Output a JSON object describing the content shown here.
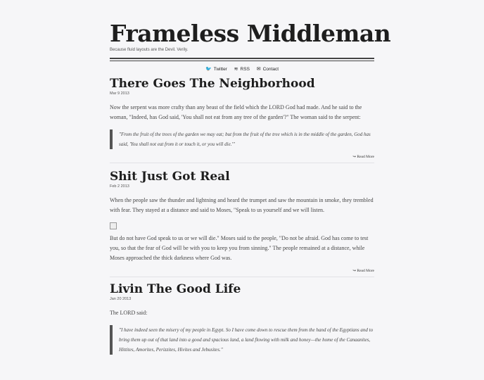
{
  "site": {
    "title": "Frameless Middleman",
    "tagline": "Because fluid layouts are the Devil. Verily."
  },
  "nav": [
    {
      "icon": "twitter-icon",
      "glyph": "🐦",
      "label": "Twitter"
    },
    {
      "icon": "rss-icon",
      "glyph": "≋",
      "label": "RSS"
    },
    {
      "icon": "envelope-icon",
      "glyph": "✉",
      "label": "Contact"
    }
  ],
  "posts": [
    {
      "title": "There Goes The Neighborhood",
      "date": "Mar 9 2013",
      "p1": "Now the serpent was more crafty than any beast of the field which the LORD God had made. And he said to the woman, \"Indeed, has God said, 'You shall not eat from any tree of the garden'?\" The woman said to the serpent:",
      "quote": "\"From the fruit of the trees of the garden we may eat; but from the fruit of the tree which is in the middle of the garden, God has said, 'You shall not eat from it or touch it, or you will die.'\"",
      "read_more": "Read More"
    },
    {
      "title": "Shit Just Got Real",
      "date": "Feb 2 2013",
      "p1": "When the people saw the thunder and lightning and heard the trumpet and saw the mountain in smoke, they trembled with fear. They stayed at a distance and said to Moses, \"Speak to us yourself and we will listen.",
      "p2": "But do not have God speak to us or we will die.\" Moses said to the people, \"Do not be afraid. God has come to test you, so that the fear of God will be with you to keep you from sinning.\" The people remained at a distance, while Moses approached the thick darkness where God was.",
      "read_more": "Read More"
    },
    {
      "title": "Livin The Good Life",
      "date": "Jan 20 2013",
      "p1": "The LORD said:",
      "quote": "\"I have indeed seen the misery of my people in Egypt. So I have come down to rescue them from the hand of the Egyptians and to bring them up out of that land into a good and spacious land, a land flowing with milk and honey—the home of the Canaanites, Hittites, Amorites, Perizzites, Hivites and Jebusites.\""
    }
  ],
  "colors": {
    "background": "#f6f6f8",
    "text": "#333333",
    "rule": "#444444",
    "quote_border": "#555555"
  }
}
